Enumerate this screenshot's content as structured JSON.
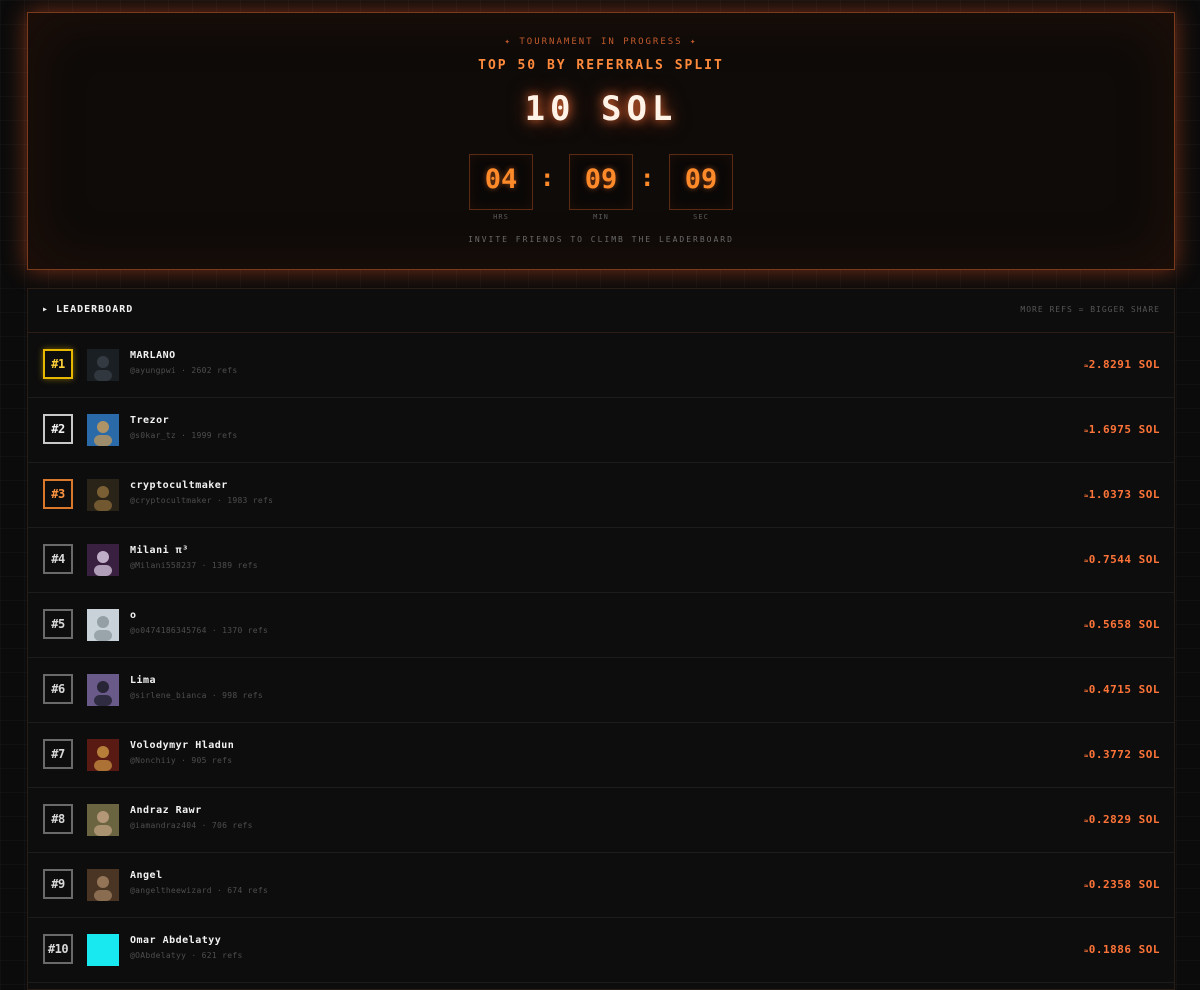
{
  "hero": {
    "status": "✦ TOURNAMENT IN PROGRESS ✦",
    "headline": "TOP 50 BY REFERRALS SPLIT",
    "prize": "10 SOL",
    "timer": {
      "hours": "04",
      "minutes": "09",
      "seconds": "09",
      "hours_label": "HRS",
      "minutes_label": "MIN",
      "seconds_label": "SEC",
      "separator": ":"
    },
    "invite": "INVITE FRIENDS TO CLIMB THE LEADERBOARD"
  },
  "leaderboard": {
    "title": "▸ LEADERBOARD",
    "note": "MORE REFS = BIGGER SHARE",
    "approx_symbol": "≈",
    "rows": [
      {
        "rank": "#1",
        "name": "MARLANO",
        "meta": "@ayungpwi · 2602 refs",
        "share": "2.8291 SOL",
        "avatar_color": "#1a1f24",
        "avatar_accent": "#3a4048"
      },
      {
        "rank": "#2",
        "name": "Trezor",
        "meta": "@s0kar_tz · 1999 refs",
        "share": "1.6975 SOL",
        "avatar_color": "#2a6aa8",
        "avatar_accent": "#c49a5a"
      },
      {
        "rank": "#3",
        "name": "cryptocultmaker",
        "meta": "@cryptocultmaker · 1983 refs",
        "share": "1.0373 SOL",
        "avatar_color": "#2a2418",
        "avatar_accent": "#8a6a3a"
      },
      {
        "rank": "#4",
        "name": "Milani π³",
        "meta": "@Milani558237 · 1389 refs",
        "share": "0.7544 SOL",
        "avatar_color": "#3a2040",
        "avatar_accent": "#d8c8e0"
      },
      {
        "rank": "#5",
        "name": "o",
        "meta": "@o0474186345764 · 1370 refs",
        "share": "0.5658 SOL",
        "avatar_color": "#c8d2d8",
        "avatar_accent": "#8a969c"
      },
      {
        "rank": "#6",
        "name": "Lima",
        "meta": "@sirlene_bianca · 998 refs",
        "share": "0.4715 SOL",
        "avatar_color": "#6a5a8a",
        "avatar_accent": "#1c1c28"
      },
      {
        "rank": "#7",
        "name": "Volodymyr Hladun",
        "meta": "@Nonchiiy · 905 refs",
        "share": "0.3772 SOL",
        "avatar_color": "#5a1a14",
        "avatar_accent": "#c89040"
      },
      {
        "rank": "#8",
        "name": "Andraz Rawr",
        "meta": "@iamandraz404 · 706 refs",
        "share": "0.2829 SOL",
        "avatar_color": "#6a6440",
        "avatar_accent": "#c0a080"
      },
      {
        "rank": "#9",
        "name": "Angel",
        "meta": "@angeltheewizard · 674 refs",
        "share": "0.2358 SOL",
        "avatar_color": "#4a3424",
        "avatar_accent": "#a08060"
      },
      {
        "rank": "#10",
        "name": "Omar Abdelatyy",
        "meta": "@OAbdelatyy · 621 refs",
        "share": "0.1886 SOL",
        "avatar_color": "#18e8f0",
        "avatar_accent": "#10c8d0"
      }
    ]
  }
}
